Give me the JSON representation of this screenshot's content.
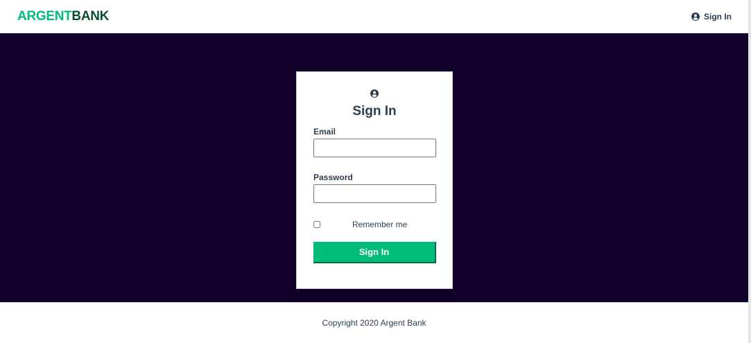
{
  "header": {
    "logo_part1": "ARGENT",
    "logo_part2": "BANK",
    "signin_label": "Sign In"
  },
  "login": {
    "title": "Sign In",
    "email_label": "Email",
    "email_value": "",
    "password_label": "Password",
    "password_value": "",
    "remember_label": "Remember me",
    "remember_checked": false,
    "submit_label": "Sign In"
  },
  "footer": {
    "copyright": "Copyright 2020 Argent Bank"
  },
  "colors": {
    "brand_green": "#00bc77",
    "brand_dark_green": "#0b4e2f",
    "hero_background": "#12002b",
    "text": "#2c3e50"
  },
  "icons": {
    "nav_user": "user-circle-icon",
    "card_user": "user-circle-icon"
  }
}
